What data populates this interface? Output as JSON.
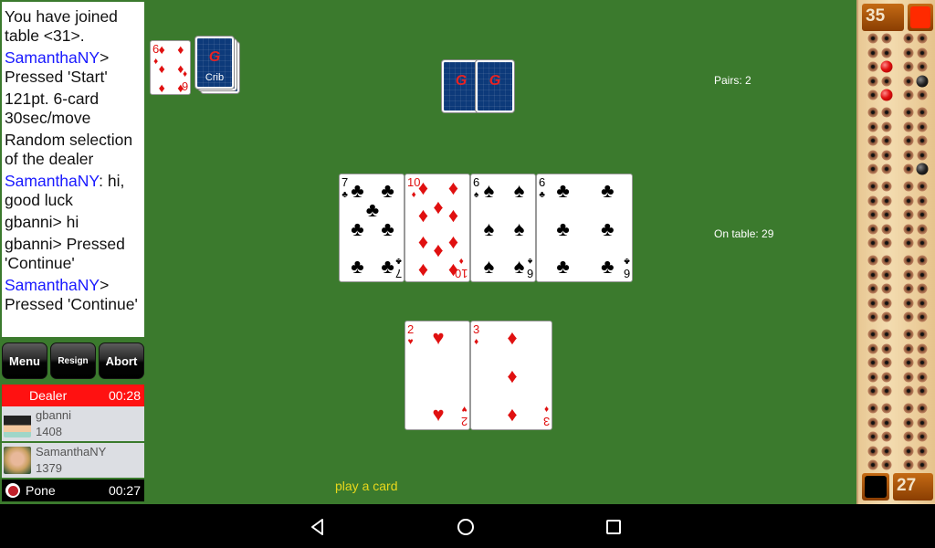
{
  "chat": [
    {
      "user": "",
      "text": "You have joined table <31>."
    },
    {
      "user": "SamanthaNY",
      "sep": ">",
      "text": " Pressed 'Start'"
    },
    {
      "user": "",
      "text": "121pt. 6-card 30sec/move"
    },
    {
      "user": "",
      "text": "Random selection of the dealer"
    },
    {
      "user": "SamanthaNY",
      "sep": ":",
      "text": " hi, good luck"
    },
    {
      "user": "",
      "text": "gbanni>  hi"
    },
    {
      "user": "",
      "text": "gbanni>  Pressed 'Continue'"
    },
    {
      "user": "SamanthaNY",
      "sep": ">",
      "text": " Pressed 'Continue'"
    }
  ],
  "buttons": {
    "menu": "Menu",
    "resign": "Resign",
    "abort": "Abort"
  },
  "players": {
    "dealer": {
      "role": "Dealer",
      "timer": "00:28",
      "name": "gbanni",
      "rating": "1408",
      "avatar": "cartoon-avatar"
    },
    "pone": {
      "role": "Pone",
      "timer": "00:27",
      "name": "SamanthaNY",
      "rating": "1379",
      "avatar": "photo-avatar"
    }
  },
  "starter": {
    "rank": "6",
    "suit": "♦",
    "color": "red"
  },
  "crib": {
    "label": "Crib",
    "logo": "G"
  },
  "opponent_hand": {
    "count": 2,
    "logo": "G"
  },
  "table_cards": [
    {
      "rank": "7",
      "suit": "♣",
      "color": "black"
    },
    {
      "rank": "10",
      "suit": "♦",
      "color": "red"
    },
    {
      "rank": "6",
      "suit": "♠",
      "color": "black"
    },
    {
      "rank": "6",
      "suit": "♣",
      "color": "black"
    }
  ],
  "hand_cards": [
    {
      "rank": "2",
      "suit": "♥",
      "color": "red"
    },
    {
      "rank": "3",
      "suit": "♦",
      "color": "red"
    }
  ],
  "info": {
    "pairs": "Pairs: 2",
    "on_table": "On table: 29"
  },
  "prompt": "play a card",
  "board": {
    "top_score": "35",
    "top_color": "#ff2a00",
    "bottom_score": "27",
    "bottom_color": "#000000",
    "pegs": [
      {
        "color": "red",
        "col": 1,
        "row": 2
      },
      {
        "color": "red",
        "col": 1,
        "row": 4
      },
      {
        "color": "black",
        "col": 3,
        "row": 3
      },
      {
        "color": "black",
        "col": 3,
        "row": 9
      }
    ]
  },
  "nav": {
    "back": "back-icon",
    "home": "home-icon",
    "recents": "recents-icon"
  }
}
